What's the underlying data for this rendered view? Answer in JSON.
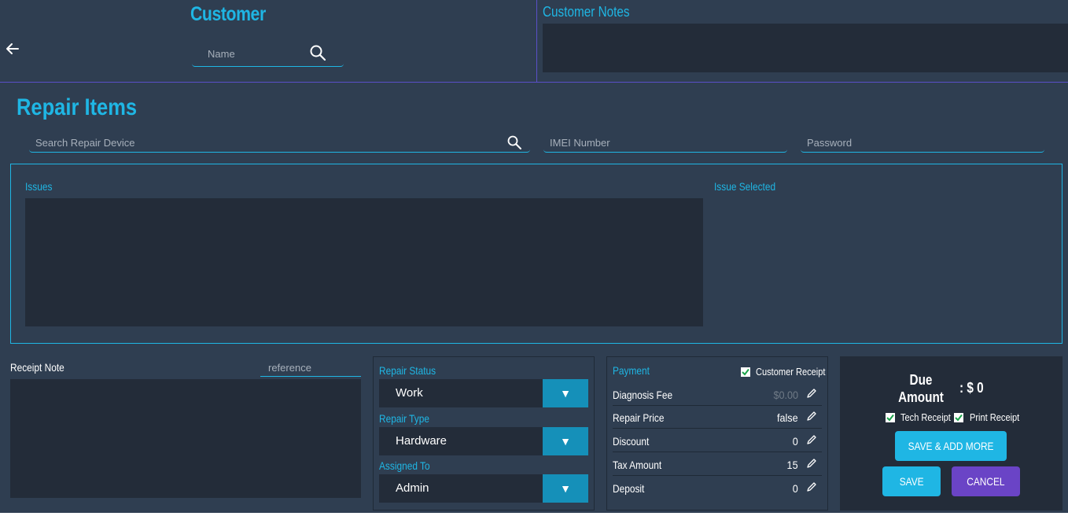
{
  "header": {
    "customer_title": "Customer",
    "name_placeholder": "Name",
    "notes_title": "Customer Notes"
  },
  "repair": {
    "title": "Repair Items",
    "search_placeholder": "Search Repair Device",
    "imei_placeholder": "IMEI Number",
    "password_placeholder": "Password",
    "issues_label": "Issues",
    "issue_selected_label": "Issue Selected"
  },
  "receipt": {
    "label": "Receipt Note",
    "reference_placeholder": "reference"
  },
  "status": {
    "repair_status_label": "Repair Status",
    "repair_status_value": "Work",
    "repair_type_label": "Repair Type",
    "repair_type_value": "Hardware",
    "assigned_label": "Assigned To",
    "assigned_value": "Admin"
  },
  "payment": {
    "title": "Payment",
    "customer_receipt_label": "Customer Receipt",
    "rows": [
      {
        "label": "Diagnosis Fee",
        "value": "$0.00"
      },
      {
        "label": "Repair Price",
        "value": "false"
      },
      {
        "label": "Discount",
        "value": "0"
      },
      {
        "label": "Tax Amount",
        "value": "15"
      },
      {
        "label": "Deposit",
        "value": "0"
      }
    ]
  },
  "due": {
    "label_line1": "Due",
    "label_line2": "Amount",
    "value": ": $ 0",
    "tech_receipt_label": "Tech Receipt",
    "print_receipt_label": "Print Receipt",
    "save_add_more_label": "SAVE & ADD MORE",
    "save_label": "SAVE",
    "cancel_label": "CANCEL"
  },
  "colors": {
    "accent": "#1fb6e4",
    "background": "#2f3e51",
    "panel_dark": "#232c39",
    "purple": "#6a44c6",
    "select_button": "#1590b9"
  }
}
